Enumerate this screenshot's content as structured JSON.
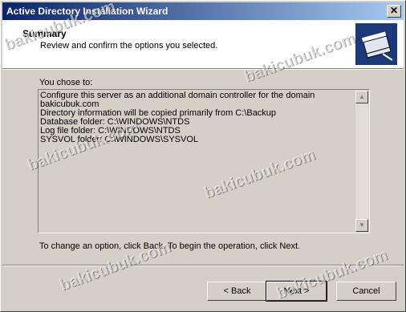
{
  "window": {
    "title": "Active Directory Installation Wizard",
    "close_glyph": "✕"
  },
  "header": {
    "title": "Summary",
    "subtitle": "Review and confirm the options you selected."
  },
  "summary": {
    "label": "You chose to:",
    "lines": [
      "Configure this server as an additional domain controller for the domain",
      "bakicubuk.com",
      "",
      "Directory information will be copied primarily from C:\\Backup",
      "",
      "Database folder: C:\\WINDOWS\\NTDS",
      "Log file folder: C:\\WINDOWS\\NTDS",
      "SYSVOL folder: C:\\WINDOWS\\SYSVOL"
    ]
  },
  "instruction": "To change an option, click Back. To begin the operation, click Next.",
  "buttons": {
    "back": "< Back",
    "next": "Next >",
    "cancel": "Cancel"
  },
  "watermark": "bakicubuk.com"
}
